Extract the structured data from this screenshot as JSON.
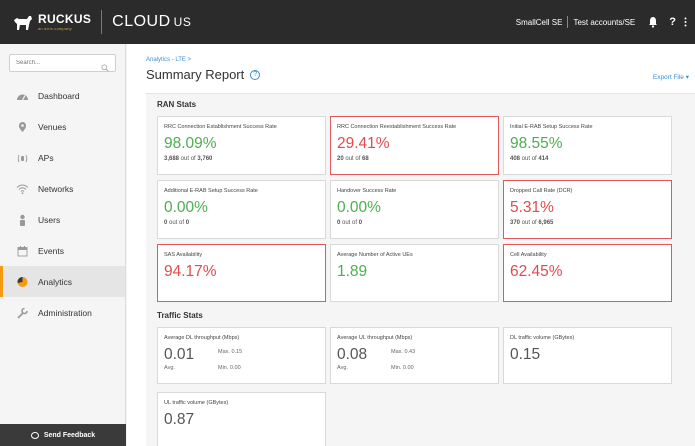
{
  "header": {
    "logo_text": "RUCKUS",
    "logo_sub": "an arris company",
    "brand": "CLOUD",
    "region": "US",
    "tenant": "SmallCell SE",
    "account": "Test accounts/SE",
    "help": "?"
  },
  "sidebar": {
    "search_placeholder": "Search...",
    "items": [
      {
        "label": "Dashboard",
        "icon": "dashboard-icon"
      },
      {
        "label": "Venues",
        "icon": "location-pin-icon"
      },
      {
        "label": "APs",
        "icon": "access-point-icon"
      },
      {
        "label": "Networks",
        "icon": "wifi-icon"
      },
      {
        "label": "Users",
        "icon": "user-icon"
      },
      {
        "label": "Events",
        "icon": "calendar-icon"
      },
      {
        "label": "Analytics",
        "icon": "pie-chart-icon"
      },
      {
        "label": "Administration",
        "icon": "wrench-icon"
      }
    ],
    "active": "Analytics",
    "feedback": "Send Feedback"
  },
  "main": {
    "breadcrumb": "Analytics - LTE >",
    "title": "Summary Report",
    "export": "Export File ▾",
    "ran_header": "RAN Stats",
    "traffic_header": "Traffic Stats",
    "ran_cards": [
      {
        "label": "RRC Connection Establishment Success Rate",
        "value": "98.09%",
        "status": "green",
        "sub_a": "3,688",
        "sub_mid": " out of ",
        "sub_b": "3,760"
      },
      {
        "label": "RRC Connection Reestablishment Success Rate",
        "value": "29.41%",
        "status": "red",
        "sub_a": "20",
        "sub_mid": " out of ",
        "sub_b": "68"
      },
      {
        "label": "Initial E-RAB Setup Success Rate",
        "value": "98.55%",
        "status": "green",
        "sub_a": "408",
        "sub_mid": " out of ",
        "sub_b": "414"
      },
      {
        "label": "Additional E-RAB Setup Success Rate",
        "value": "0.00%",
        "status": "green",
        "sub_a": "0",
        "sub_mid": " out of ",
        "sub_b": "0"
      },
      {
        "label": "Handover Success Rate",
        "value": "0.00%",
        "status": "green",
        "sub_a": "0",
        "sub_mid": " out of ",
        "sub_b": "0"
      },
      {
        "label": "Dropped Call Rate (DCR)",
        "value": "5.31%",
        "status": "red",
        "sub_a": "370",
        "sub_mid": " out of ",
        "sub_b": "6,965"
      },
      {
        "label": "SAS Availability",
        "value": "94.17%",
        "status": "red"
      },
      {
        "label": "Average Number of Active UEs",
        "value": "1.89",
        "status": "green"
      },
      {
        "label": "Cell Availability",
        "value": "62.45%",
        "status": "red"
      }
    ],
    "traffic_cards": [
      {
        "label": "Average DL throughput (Mbps)",
        "value": "0.01",
        "max": "Max. 0.15",
        "avg": "Avg.",
        "min": "Min. 0.00"
      },
      {
        "label": "Average UL throughput (Mbps)",
        "value": "0.08",
        "max": "Max. 0.43",
        "avg": "Avg.",
        "min": "Min. 0.00"
      },
      {
        "label": "DL traffic volume (GBytes)",
        "value": "0.15"
      },
      {
        "label": "UL traffic volume (GBytes)",
        "value": "0.87"
      }
    ]
  },
  "colors": {
    "green": "#4caf50",
    "red": "#e04c4c",
    "accent": "#f39c12",
    "link": "#3b8fd0"
  }
}
